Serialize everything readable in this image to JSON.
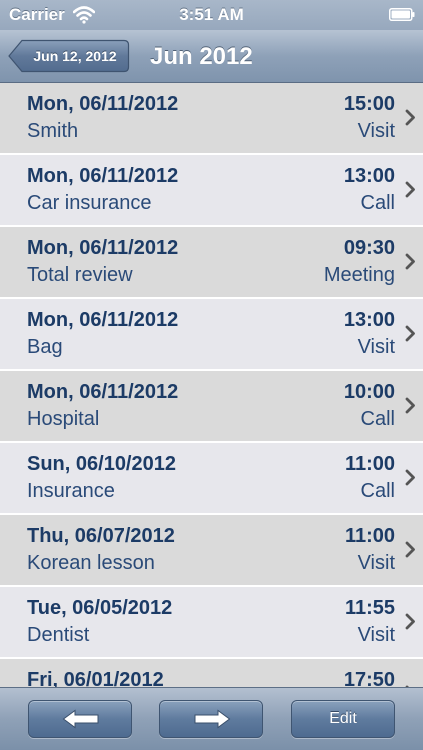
{
  "status_bar": {
    "carrier": "Carrier",
    "time": "3:51 AM"
  },
  "nav": {
    "back_label": "Jun 12, 2012",
    "title": "Jun 2012"
  },
  "rows": [
    {
      "date": "Mon, 06/11/2012",
      "title": "Smith",
      "time": "15:00",
      "type": "Visit"
    },
    {
      "date": "Mon, 06/11/2012",
      "title": "Car insurance",
      "time": "13:00",
      "type": "Call"
    },
    {
      "date": "Mon, 06/11/2012",
      "title": "Total review",
      "time": "09:30",
      "type": "Meeting"
    },
    {
      "date": "Mon, 06/11/2012",
      "title": "Bag",
      "time": "13:00",
      "type": "Visit"
    },
    {
      "date": "Mon, 06/11/2012",
      "title": "Hospital",
      "time": "10:00",
      "type": "Call"
    },
    {
      "date": "Sun, 06/10/2012",
      "title": "Insurance",
      "time": "11:00",
      "type": "Call"
    },
    {
      "date": "Thu, 06/07/2012",
      "title": "Korean lesson",
      "time": "11:00",
      "type": "Visit"
    },
    {
      "date": "Tue, 06/05/2012",
      "title": "Dentist",
      "time": "11:55",
      "type": "Visit"
    },
    {
      "date": "Fri, 06/01/2012",
      "title": "",
      "time": "17:50",
      "type": ""
    }
  ],
  "toolbar": {
    "prev_icon": "arrow-left-icon",
    "next_icon": "arrow-right-icon",
    "edit_label": "Edit"
  },
  "colors": {
    "text_primary": "#1c3b66",
    "row_odd": "#dadada",
    "row_even": "#e7e7ec",
    "bar_accent": "#8ea1b8"
  }
}
